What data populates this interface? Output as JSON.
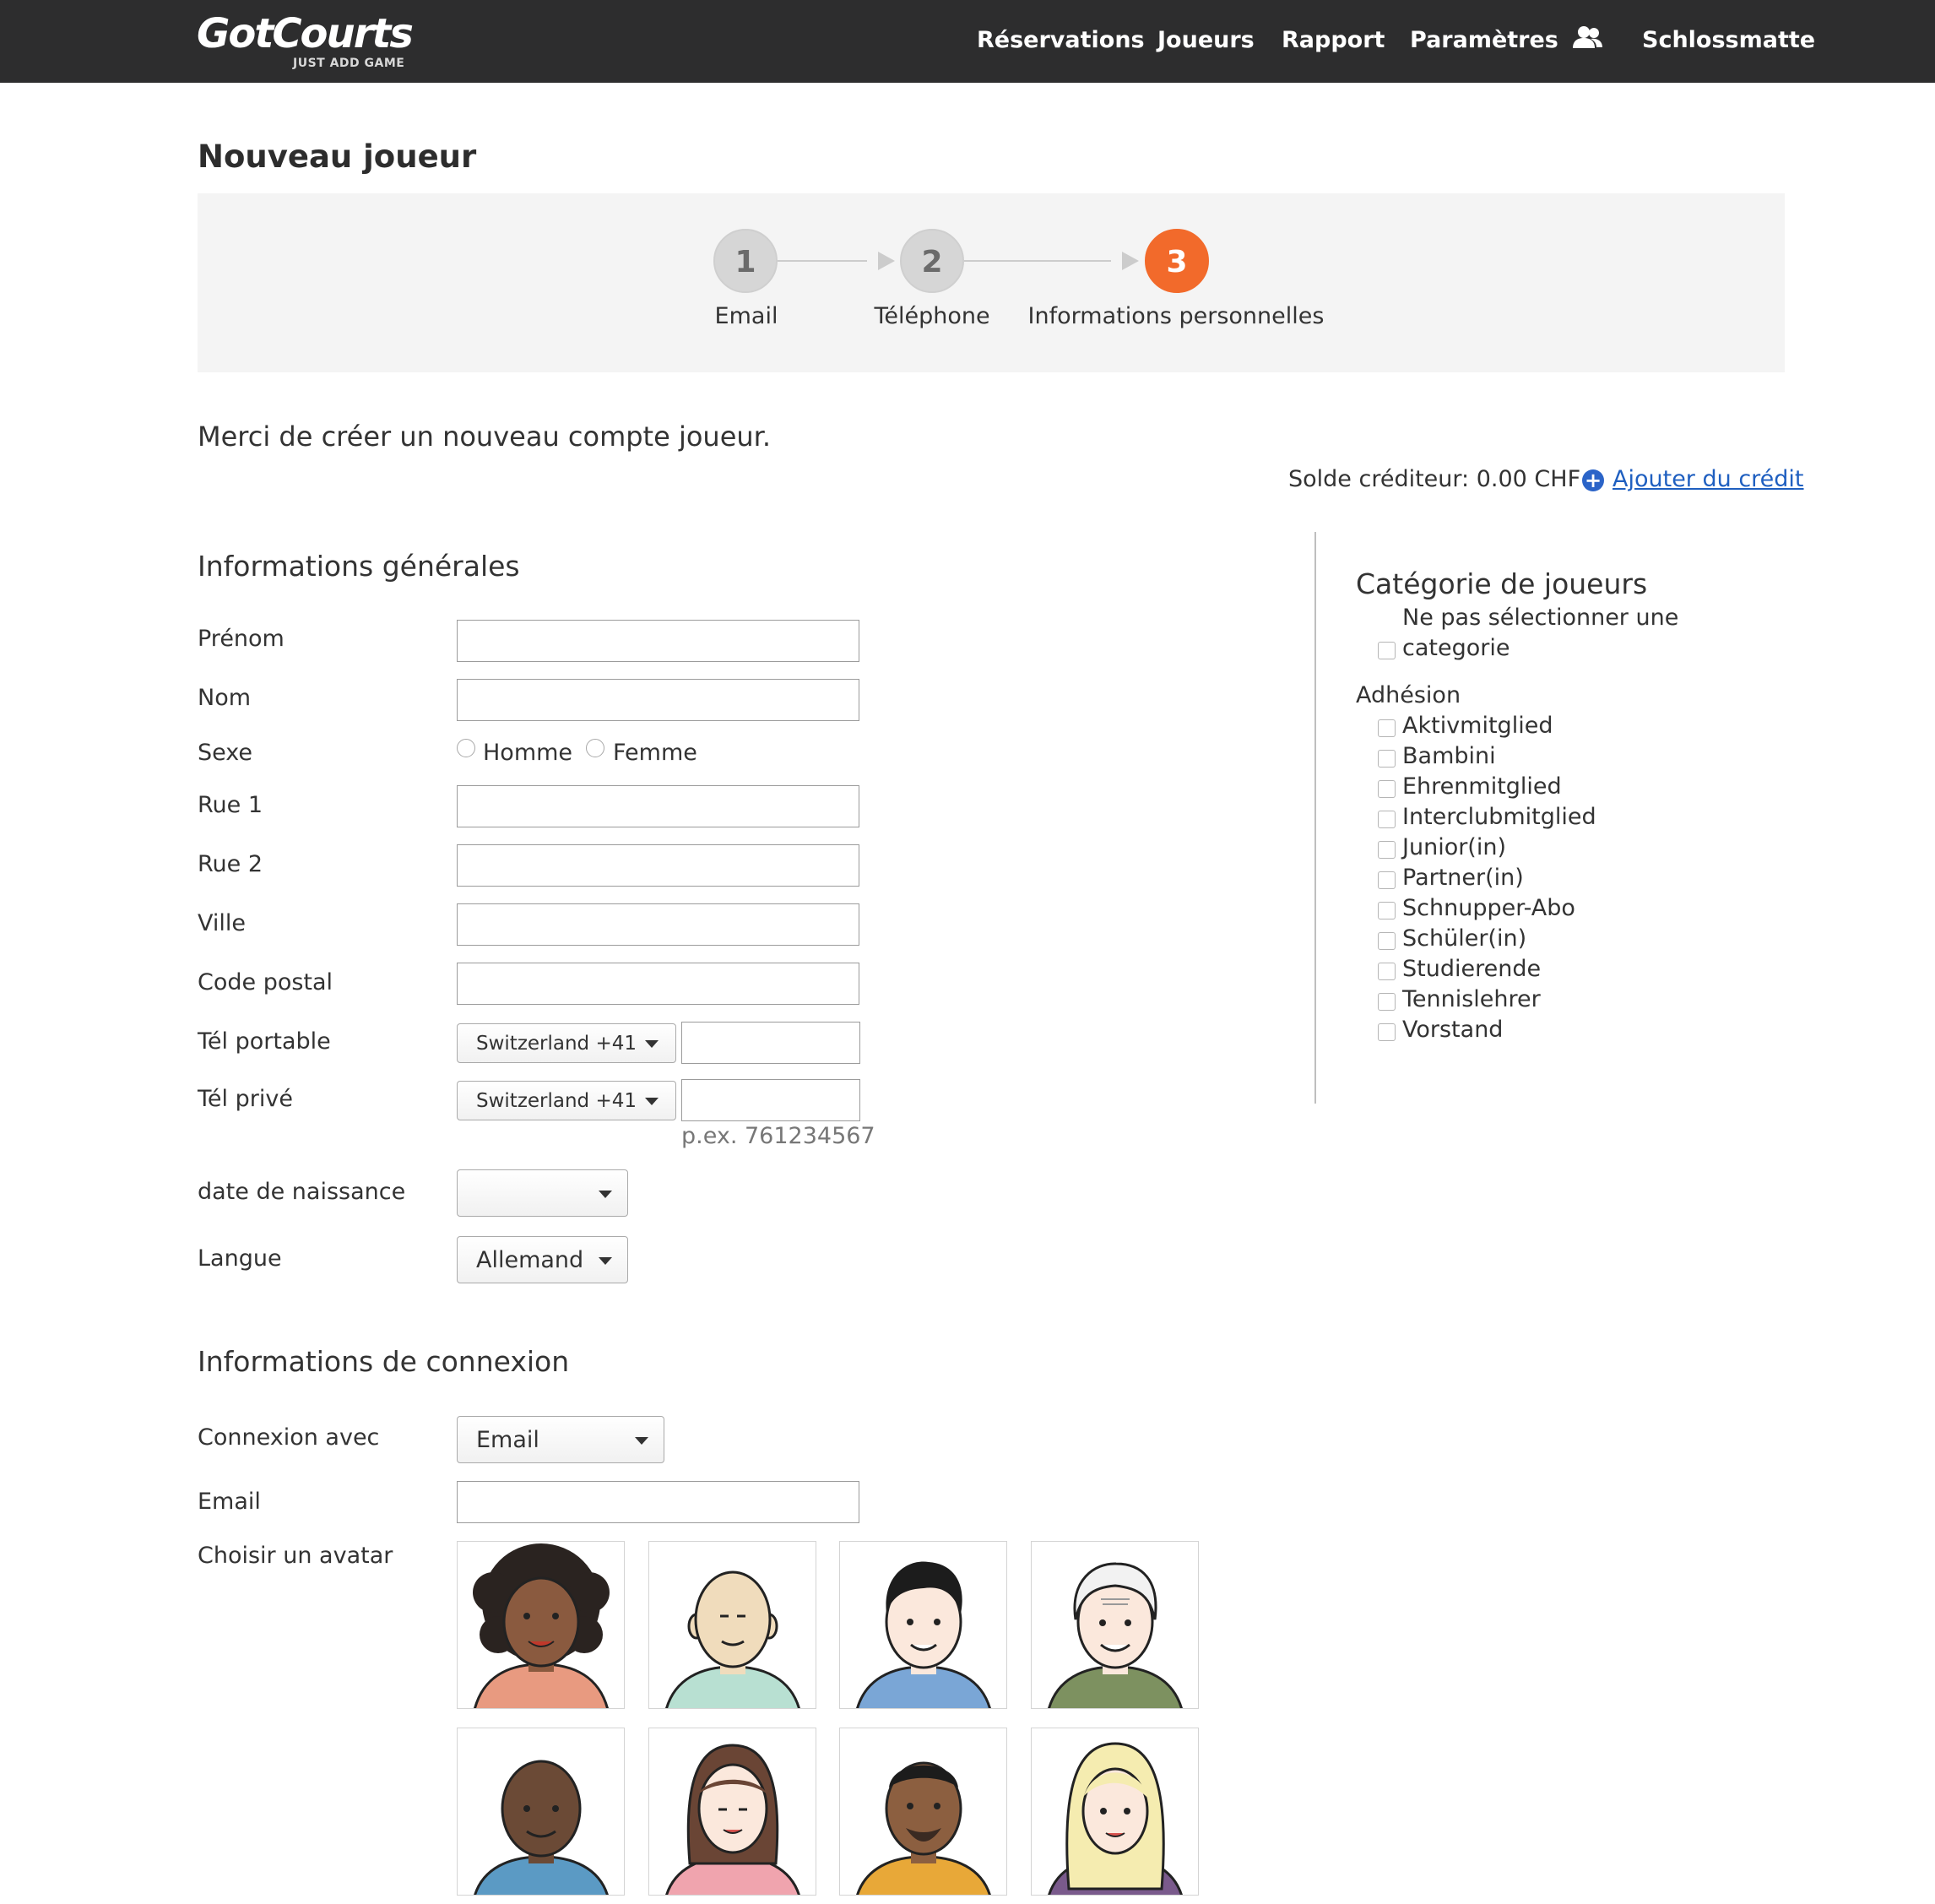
{
  "header": {
    "logo_text": "GotCourts",
    "logo_tagline": "JUST ADD GAME",
    "nav": {
      "reservations": "Réservations",
      "players": "Joueurs",
      "report": "Rapport",
      "settings": "Paramètres",
      "club": "Schlossmatte"
    },
    "user_icon": "users-icon"
  },
  "page": {
    "title": "Nouveau joueur",
    "intro": "Merci de créer un nouveau compte joueur.",
    "credit_balance": "Solde créditeur: 0.00 CHF",
    "add_credit": "Ajouter du crédit"
  },
  "stepper": {
    "steps": [
      {
        "number": "1",
        "label": "Email"
      },
      {
        "number": "2",
        "label": "Téléphone"
      },
      {
        "number": "3",
        "label": "Informations personnelles"
      }
    ],
    "active_step": 3,
    "active_color": "#f26a2b"
  },
  "general": {
    "heading": "Informations générales",
    "first_name_label": "Prénom",
    "first_name_value": "",
    "last_name_label": "Nom",
    "last_name_value": "",
    "gender_label": "Sexe",
    "gender_options": [
      "Homme",
      "Femme"
    ],
    "street1_label": "Rue 1",
    "street2_label": "Rue 2",
    "city_label": "Ville",
    "zip_label": "Code postal",
    "mobile_label": "Tél portable",
    "mobile_country": "Switzerland +41",
    "home_label": "Tél privé",
    "home_country": "Switzerland +41",
    "phone_hint": "p.ex. 761234567",
    "birthdate_label": "date de naissance",
    "birthdate_value": "",
    "language_label": "Langue",
    "language_value": "Allemand"
  },
  "login": {
    "heading": "Informations de connexion",
    "login_with_label": "Connexion avec",
    "login_with_value": "Email",
    "email_label": "Email",
    "email_value": "",
    "avatar_label": "Choisir un avatar"
  },
  "sidebar": {
    "category_heading": "Catégorie de joueurs",
    "no_category_line1": "Ne pas sélectionner une",
    "no_category_line2": "categorie",
    "membership_heading": "Adhésion",
    "memberships": [
      "Aktivmitglied",
      "Bambini",
      "Ehrenmitglied",
      "Interclubmitglied",
      "Junior(in)",
      "Partner(in)",
      "Schnupper-Abo",
      "Schüler(in)",
      "Studierende",
      "Tennislehrer",
      "Vorstand"
    ]
  },
  "colors": {
    "topbar": "#2d2d2e",
    "accent": "#f26a2b",
    "link": "#1f5fc0"
  }
}
